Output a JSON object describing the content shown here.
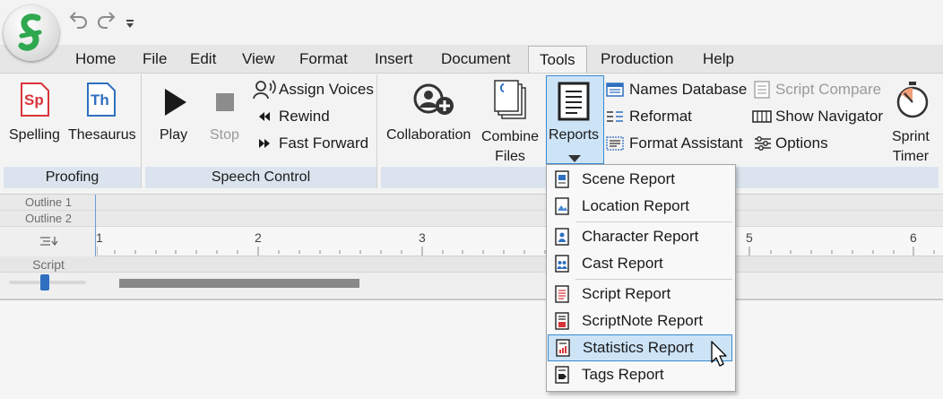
{
  "menu": {
    "tabs": [
      "Home",
      "File",
      "Edit",
      "View",
      "Format",
      "Insert",
      "Document",
      "Tools",
      "Production",
      "Help"
    ],
    "active_tab": "Tools"
  },
  "ribbon": {
    "proofing": {
      "label": "Proofing",
      "spelling": "Spelling",
      "thesaurus": "Thesaurus",
      "sp_glyph": "Sp",
      "th_glyph": "Th"
    },
    "speech": {
      "label": "Speech Control",
      "play": "Play",
      "stop": "Stop",
      "assign_voices": "Assign Voices",
      "rewind": "Rewind",
      "fast_forward": "Fast Forward"
    },
    "tools": {
      "collaboration": "Collaboration",
      "combine_line1": "Combine",
      "combine_line2": "Files",
      "reports": "Reports",
      "names_database": "Names Database",
      "reformat": "Reformat",
      "format_assistant": "Format Assistant",
      "script_compare": "Script Compare",
      "show_navigator": "Show Navigator",
      "options": "Options",
      "sprint_line1": "Sprint",
      "sprint_line2": "Timer"
    }
  },
  "outline": {
    "outline1": "Outline 1",
    "outline2": "Outline 2",
    "script": "Script",
    "ruler_numbers": [
      "1",
      "2",
      "3",
      "5",
      "6"
    ]
  },
  "reports_menu": {
    "items": [
      {
        "label": "Scene Report",
        "icon": "scene-report-icon"
      },
      {
        "label": "Location Report",
        "icon": "location-report-icon"
      },
      {
        "label": "Character Report",
        "icon": "character-report-icon"
      },
      {
        "label": "Cast Report",
        "icon": "cast-report-icon"
      },
      {
        "label": "Script Report",
        "icon": "script-report-icon"
      },
      {
        "label": "ScriptNote Report",
        "icon": "scriptnote-report-icon"
      },
      {
        "label": "Statistics Report",
        "icon": "statistics-report-icon"
      },
      {
        "label": "Tags Report",
        "icon": "tags-report-icon"
      }
    ],
    "highlighted": "Statistics Report"
  },
  "colors": {
    "accent_blue": "#2f6fc1",
    "hover_fill": "#cde4f7",
    "group_label_bg": "#dbe4ee",
    "spelling_red": "#d9343a"
  }
}
